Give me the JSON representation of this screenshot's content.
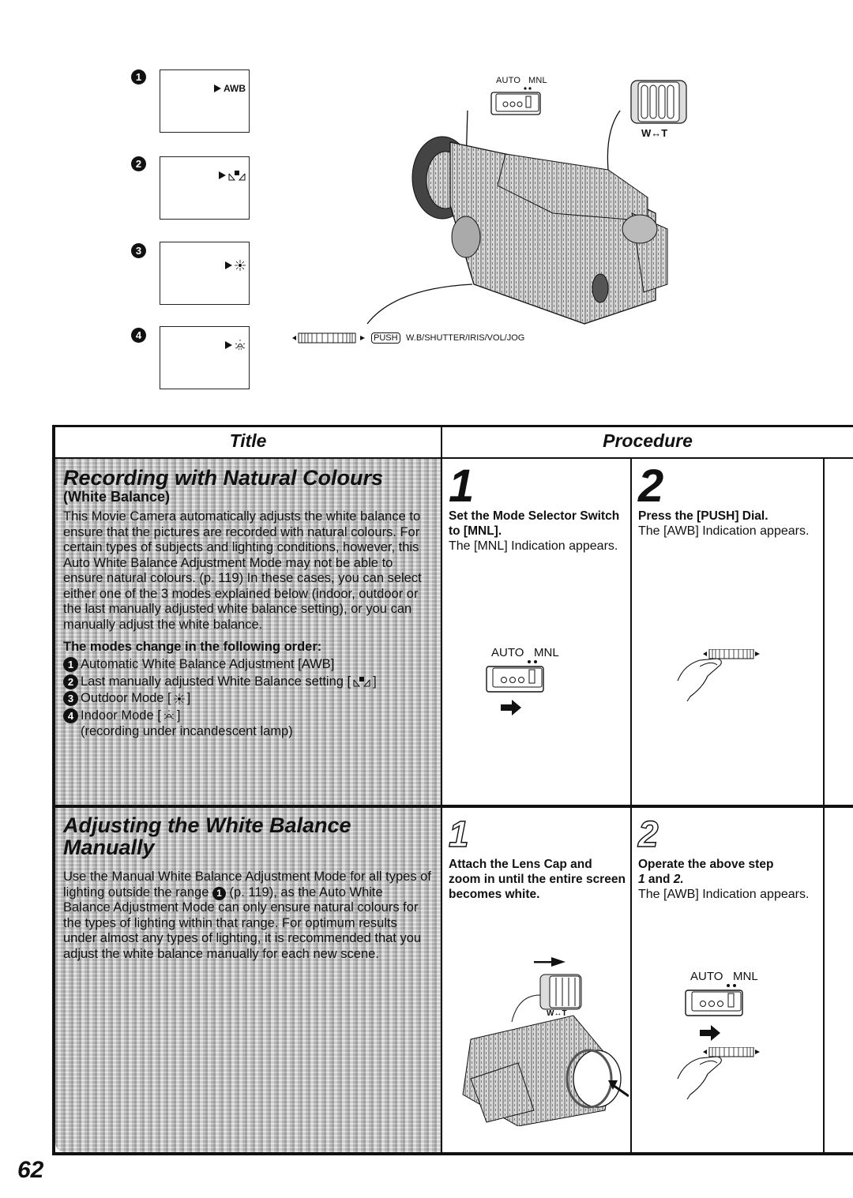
{
  "top_figure": {
    "screens": [
      {
        "num": "1",
        "indicator": "AWB",
        "icon": "awb-text"
      },
      {
        "num": "2",
        "indicator": "",
        "icon": "manual-wb-icon"
      },
      {
        "num": "3",
        "indicator": "",
        "icon": "sun-icon"
      },
      {
        "num": "4",
        "indicator": "",
        "icon": "lamp-icon"
      }
    ],
    "switch_labels": {
      "auto": "AUTO",
      "mnl": "MNL"
    },
    "zoom_label": "W↔T",
    "push_badge": "PUSH",
    "dial_label": "W.B/SHUTTER/IRIS/VOL/JOG"
  },
  "table": {
    "headers": {
      "title": "Title",
      "procedure": "Procedure"
    },
    "section1": {
      "title": "Recording with Natural Colours",
      "subtitle": "(White Balance)",
      "body": "This Movie Camera automatically adjusts the white balance to ensure that the pictures are recorded with natural colours. For certain types of subjects and lighting conditions, however, this Auto White Balance Adjustment Mode may not be able to ensure natural colours. (p. 119) In these cases, you can select either one of the 3 modes explained below (indoor, outdoor or the last manually adjusted white balance setting), or you can manually adjust the white balance.",
      "modes_heading": "The modes change in the following order:",
      "modes": [
        {
          "num": "1",
          "text": "Automatic White Balance Adjustment [AWB]"
        },
        {
          "num": "2",
          "text": "Last manually adjusted White Balance setting [",
          "suffix": "]"
        },
        {
          "num": "3",
          "text": "Outdoor Mode [",
          "suffix": "]"
        },
        {
          "num": "4",
          "text": "Indoor Mode [",
          "suffix": "]",
          "note": "(recording under incandescent lamp)"
        }
      ],
      "steps": [
        {
          "num": "1",
          "bold": "Set the Mode Selector Switch to [MNL].",
          "text": "The [MNL] Indication appears.",
          "switch_auto": "AUTO",
          "switch_mnl": "MNL"
        },
        {
          "num": "2",
          "bold": "Press the [PUSH] Dial.",
          "text": "The [AWB] Indication appears."
        }
      ]
    },
    "section2": {
      "title_line1": "Adjusting the White Balance",
      "title_line2": "Manually",
      "body_pre": "Use the Manual White Balance Adjustment Mode for all types of lighting outside the range ",
      "body_ref": "1",
      "body_post": " (p. 119), as the Auto White Balance Adjustment Mode can only ensure natural colours for the types of lighting within that range. For optimum results under almost any types of lighting, it is recommended that you adjust the white balance manually for each new scene.",
      "steps": [
        {
          "num": "1",
          "bold": "Attach the Lens Cap and zoom in until the entire screen becomes white.",
          "zoom_label": "W↔T"
        },
        {
          "num": "2",
          "bold_num": "1",
          "bold_and": " and ",
          "bold_num2": "2.",
          "bold_pre": "Operate the above step",
          "text": "The [AWB] Indication appears.",
          "switch_auto": "AUTO",
          "switch_mnl": "MNL"
        }
      ]
    }
  },
  "page_number": "62"
}
